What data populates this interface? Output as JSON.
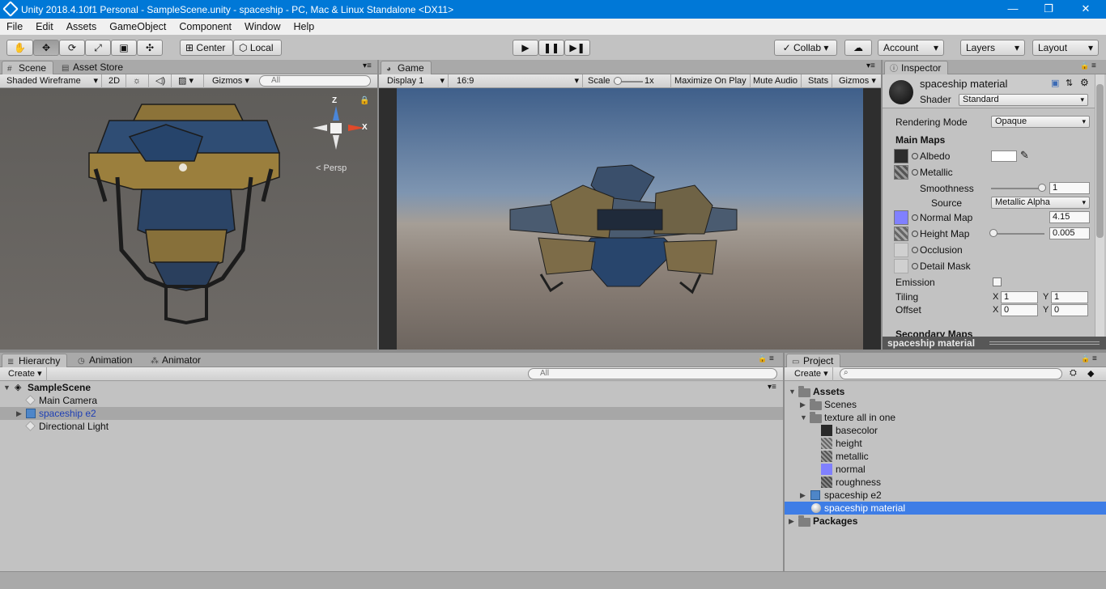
{
  "window": {
    "title": "Unity 2018.4.10f1 Personal - SampleScene.unity - spaceship - PC, Mac & Linux Standalone <DX11>",
    "minimize": "—",
    "restore": "❐",
    "close": "✕"
  },
  "menu": [
    "File",
    "Edit",
    "Assets",
    "GameObject",
    "Component",
    "Window",
    "Help"
  ],
  "toolbar": {
    "pivot": "Center",
    "space": "Local",
    "collab": "Collab",
    "account": "Account",
    "layers": "Layers",
    "layout": "Layout"
  },
  "scene": {
    "tab_scene": "Scene",
    "tab_asset_store": "Asset Store",
    "shading": "Shaded Wireframe",
    "mode_2d": "2D",
    "gizmos": "Gizmos",
    "search_placeholder": "All",
    "persp": "Persp",
    "axis_z": "Z",
    "axis_x": "X"
  },
  "game": {
    "tab": "Game",
    "display": "Display 1",
    "aspect": "16:9",
    "scale_label": "Scale",
    "scale_value": "1x",
    "maximize": "Maximize On Play",
    "mute": "Mute Audio",
    "stats": "Stats",
    "gizmos": "Gizmos"
  },
  "inspector": {
    "tab": "Inspector",
    "material_name": "spaceship material",
    "shader_label": "Shader",
    "shader_value": "Standard",
    "rendering_mode_label": "Rendering Mode",
    "rendering_mode_value": "Opaque",
    "main_maps": "Main Maps",
    "albedo": "Albedo",
    "metallic": "Metallic",
    "smoothness": "Smoothness",
    "smoothness_value": "1",
    "source_label": "Source",
    "source_value": "Metallic Alpha",
    "normal_map": "Normal Map",
    "normal_value": "4.15",
    "height_map": "Height Map",
    "height_value": "0.005",
    "occlusion": "Occlusion",
    "detail_mask": "Detail Mask",
    "emission": "Emission",
    "tiling": "Tiling",
    "offset": "Offset",
    "x": "X",
    "y": "Y",
    "tiling_x": "1",
    "tiling_y": "1",
    "offset_x": "0",
    "offset_y": "0",
    "secondary_maps": "Secondary Maps",
    "footer": "spaceship material"
  },
  "hierarchy": {
    "tab": "Hierarchy",
    "tab_animation": "Animation",
    "tab_animator": "Animator",
    "create": "Create",
    "search_placeholder": "All",
    "scene": "SampleScene",
    "items": [
      "Main Camera",
      "spaceship e2",
      "Directional Light"
    ]
  },
  "project": {
    "tab": "Project",
    "create": "Create",
    "assets": "Assets",
    "scenes": "Scenes",
    "texture_folder": "texture all in one",
    "textures": [
      "basecolor",
      "height",
      "metallic",
      "normal",
      "roughness"
    ],
    "spaceship_model": "spaceship e2",
    "material": "spaceship material",
    "packages": "Packages"
  }
}
